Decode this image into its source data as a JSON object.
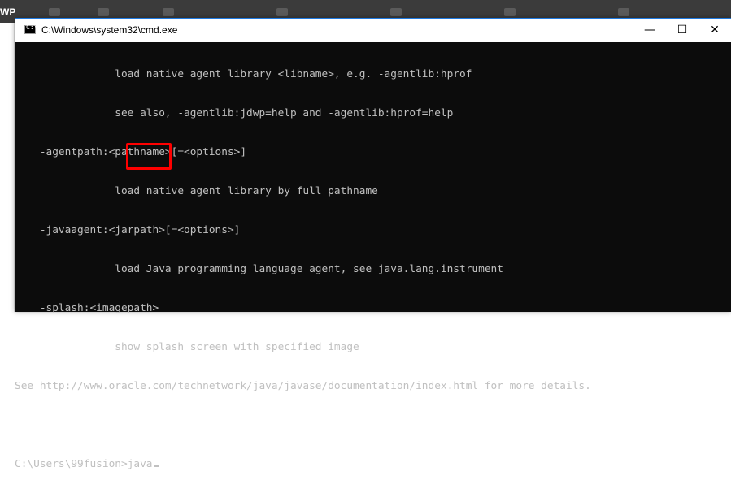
{
  "taskbar": {
    "label": "WP"
  },
  "window": {
    "title": "C:\\Windows\\system32\\cmd.exe",
    "icon": "cmd-icon",
    "controls": {
      "minimize": "—",
      "maximize": "☐",
      "close": "✕"
    }
  },
  "console": {
    "lines": [
      "                load native agent library <libname>, e.g. -agentlib:hprof",
      "                see also, -agentlib:jdwp=help and -agentlib:hprof=help",
      "    -agentpath:<pathname>[=<options>]",
      "                load native agent library by full pathname",
      "    -javaagent:<jarpath>[=<options>]",
      "                load Java programming language agent, see java.lang.instrument",
      "    -splash:<imagepath>",
      "                show splash screen with specified image",
      "See http://www.oracle.com/technetwork/java/javase/documentation/index.html for more details.",
      ""
    ],
    "prompt": "C:\\Users\\99fusion>",
    "command": "java"
  },
  "colors": {
    "console_bg": "#0c0c0c",
    "console_fg": "#c0c0c0",
    "highlight": "#ff0000",
    "titlebar_bg": "#ffffff"
  }
}
